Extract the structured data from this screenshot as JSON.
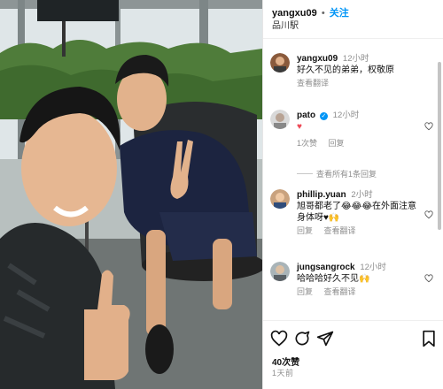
{
  "header": {
    "username": "yangxu09",
    "separator": "•",
    "follow_label": "关注",
    "location": "品川駅"
  },
  "comments": [
    {
      "username": "yangxu09",
      "time": "12小时",
      "text": "好久不见的弟弟，权敬原",
      "actions": [
        "查看翻译"
      ]
    },
    {
      "username": "pato",
      "verified": true,
      "time": "12小时",
      "text": "♥",
      "actions": [
        "1次赞",
        "回复"
      ],
      "view_replies": "查看所有1条回复"
    },
    {
      "username": "phillip.yuan",
      "time": "2小时",
      "text_line1": "旭哥都老了😂😂😂在外面注意",
      "text_line2": "身体呀♥🙌",
      "actions": [
        "回复",
        "查看翻译"
      ]
    },
    {
      "username": "jungsangrock",
      "time": "12小时",
      "text": "哈哈哈好久不见🙌",
      "actions": [
        "回复",
        "查看翻译"
      ]
    }
  ],
  "footer": {
    "likes": "40次赞",
    "date": "1天前"
  },
  "colors": {
    "accent": "#0095f6",
    "heart_red": "#ed4956",
    "muted": "#8e8e8e"
  },
  "icons": [
    "heart-icon",
    "comment-icon",
    "share-icon",
    "bookmark-icon",
    "verified-badge-icon"
  ]
}
